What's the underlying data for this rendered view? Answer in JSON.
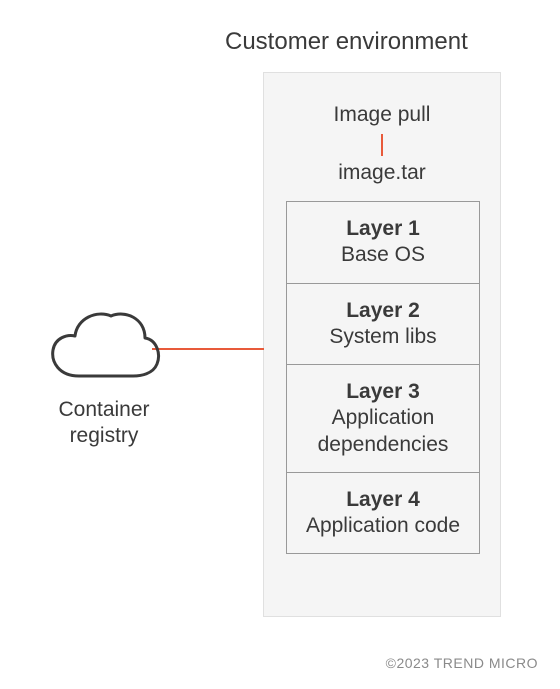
{
  "title": "Customer environment",
  "image_pull_label": "Image pull",
  "image_tar_label": "image.tar",
  "cloud_label_line1": "Container",
  "cloud_label_line2": "registry",
  "layers": [
    {
      "name": "Layer 1",
      "desc": "Base OS"
    },
    {
      "name": "Layer 2",
      "desc": "System libs"
    },
    {
      "name": "Layer 3",
      "desc": "Application dependencies"
    },
    {
      "name": "Layer 4",
      "desc": "Application code"
    }
  ],
  "copyright": "©2023 TREND MICRO",
  "colors": {
    "accent": "#e85a3a",
    "box_bg": "#f5f5f5",
    "border": "#999",
    "text": "#3a3a3a"
  }
}
